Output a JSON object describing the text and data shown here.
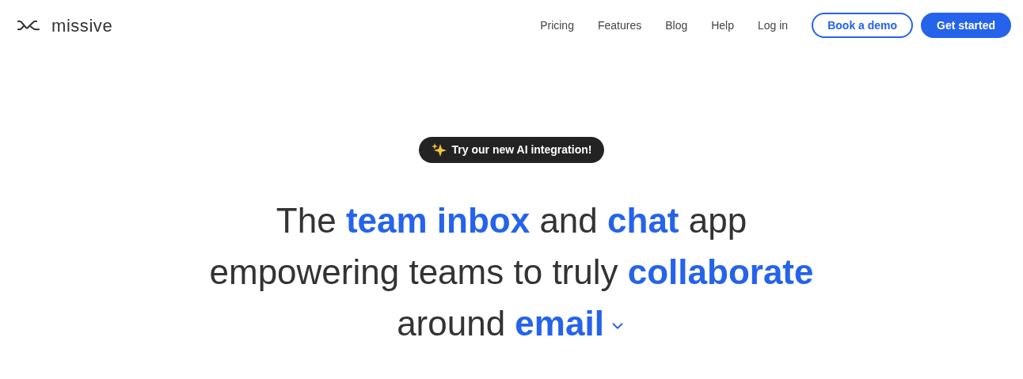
{
  "brand": {
    "name": "missive"
  },
  "nav": {
    "links": [
      "Pricing",
      "Features",
      "Blog",
      "Help",
      "Log in"
    ],
    "buttons": [
      {
        "label": "Book a demo",
        "kind": "outline"
      },
      {
        "label": "Get started",
        "kind": "solid"
      }
    ]
  },
  "announcement": {
    "label": "Try our new AI integration!"
  },
  "headline": {
    "lines": [
      [
        {
          "text": "The ",
          "emphasis": false
        },
        {
          "text": "team inbox",
          "emphasis": true
        },
        {
          "text": " and ",
          "emphasis": false
        },
        {
          "text": "chat",
          "emphasis": true
        },
        {
          "text": " app",
          "emphasis": false
        }
      ],
      [
        {
          "text": "empowering teams to truly ",
          "emphasis": false
        },
        {
          "text": "collaborate",
          "emphasis": true
        }
      ],
      [
        {
          "text": "around ",
          "emphasis": false
        },
        {
          "text": "email",
          "emphasis": true
        }
      ]
    ]
  }
}
